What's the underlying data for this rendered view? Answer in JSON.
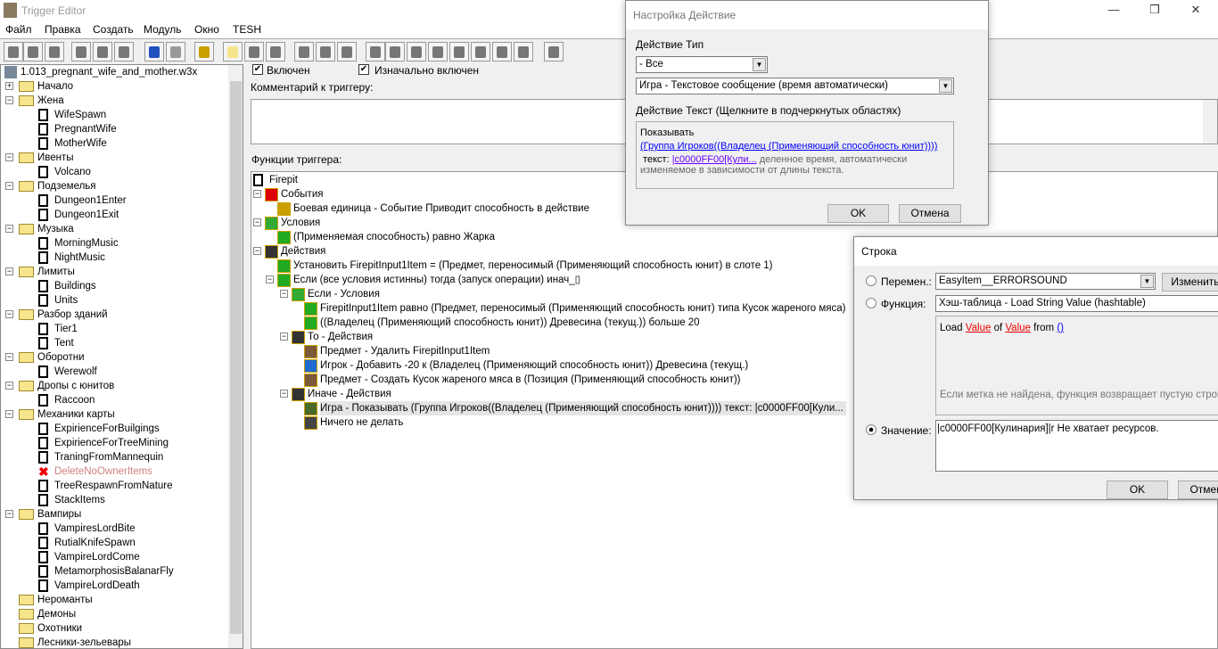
{
  "window": {
    "title": "Trigger Editor",
    "controls": [
      "—",
      "❐",
      "✕"
    ]
  },
  "menu": [
    "Файл",
    "Правка",
    "Создать",
    "Модуль",
    "Окно",
    "TESH"
  ],
  "toolbar": [
    "new",
    "open",
    "save",
    "cut",
    "copy",
    "paste",
    "undo",
    "redo",
    "variables",
    "new-category",
    "new-trigger",
    "new-comment",
    "new-event",
    "new-condition",
    "new-action",
    "terrain",
    "text",
    "sound",
    "unit",
    "item",
    "ai",
    "object",
    "import",
    "test"
  ],
  "left_tree": {
    "root": "1.013_pregnant_wife_and_mother.w3x",
    "items": [
      {
        "l": 0,
        "t": "folder",
        "e": "+",
        "label": "Начало"
      },
      {
        "l": 0,
        "t": "folder",
        "e": "-",
        "label": "Жена"
      },
      {
        "l": 1,
        "t": "trigger",
        "label": "WifeSpawn"
      },
      {
        "l": 1,
        "t": "trigger",
        "label": "PregnantWife"
      },
      {
        "l": 1,
        "t": "trigger",
        "label": "MotherWife"
      },
      {
        "l": 0,
        "t": "folder",
        "e": "-",
        "label": "Ивенты"
      },
      {
        "l": 1,
        "t": "trigger",
        "label": "Volcano"
      },
      {
        "l": 0,
        "t": "folder",
        "e": "-",
        "label": "Подземелья"
      },
      {
        "l": 1,
        "t": "trigger",
        "label": "Dungeon1Enter"
      },
      {
        "l": 1,
        "t": "trigger",
        "label": "Dungeon1Exit"
      },
      {
        "l": 0,
        "t": "folder",
        "e": "-",
        "label": "Музыка"
      },
      {
        "l": 1,
        "t": "trigger",
        "label": "MorningMusic"
      },
      {
        "l": 1,
        "t": "trigger",
        "label": "NightMusic"
      },
      {
        "l": 0,
        "t": "folder",
        "e": "-",
        "label": "Лимиты"
      },
      {
        "l": 1,
        "t": "trigger",
        "label": "Buildings"
      },
      {
        "l": 1,
        "t": "trigger",
        "label": "Units"
      },
      {
        "l": 0,
        "t": "folder",
        "e": "-",
        "label": "Разбор зданий"
      },
      {
        "l": 1,
        "t": "trigger",
        "label": "Tier1"
      },
      {
        "l": 1,
        "t": "trigger",
        "label": "Tent"
      },
      {
        "l": 0,
        "t": "folder",
        "e": "-",
        "label": "Оборотни"
      },
      {
        "l": 1,
        "t": "trigger",
        "label": "Werewolf"
      },
      {
        "l": 0,
        "t": "folder",
        "e": "-",
        "label": "Дропы с юнитов"
      },
      {
        "l": 1,
        "t": "trigger",
        "label": "Raccoon"
      },
      {
        "l": 0,
        "t": "folder",
        "e": "-",
        "label": "Механики карты"
      },
      {
        "l": 1,
        "t": "trigger",
        "label": "ExpirienceForBuilgings"
      },
      {
        "l": 1,
        "t": "trigger",
        "label": "ExpirienceForTreeMining"
      },
      {
        "l": 1,
        "t": "trigger",
        "label": "TraningFromMannequin"
      },
      {
        "l": 1,
        "t": "disabled",
        "label": "DeleteNoOwnerItems"
      },
      {
        "l": 1,
        "t": "trigger",
        "label": "TreeRespawnFromNature"
      },
      {
        "l": 1,
        "t": "trigger",
        "label": "StackItems"
      },
      {
        "l": 0,
        "t": "folder",
        "e": "-",
        "label": "Вампиры"
      },
      {
        "l": 1,
        "t": "trigger",
        "label": "VampiresLordBite"
      },
      {
        "l": 1,
        "t": "trigger",
        "label": "RutialKnifeSpawn"
      },
      {
        "l": 1,
        "t": "trigger",
        "label": "VampireLordCome"
      },
      {
        "l": 1,
        "t": "trigger",
        "label": "MetamorphosisBalanarFly"
      },
      {
        "l": 1,
        "t": "trigger",
        "label": "VampireLordDeath"
      },
      {
        "l": 0,
        "t": "folder",
        "label": "Нероманты"
      },
      {
        "l": 0,
        "t": "folder",
        "label": "Демоны"
      },
      {
        "l": 0,
        "t": "folder",
        "label": "Охотники"
      },
      {
        "l": 0,
        "t": "folder",
        "label": "Лесники-зельевары"
      }
    ]
  },
  "trigger": {
    "enabled_label": "Включен",
    "enabled": true,
    "initially_label": "Изначально включен",
    "initially": true,
    "comment_label": "Комментарий к триггеру:",
    "functions_label": "Функции триггера:",
    "functions": [
      {
        "l": 0,
        "i": "page",
        "label": "Firepit"
      },
      {
        "l": 1,
        "i": "flag",
        "e": "-",
        "label": "События"
      },
      {
        "l": 2,
        "i": "unit",
        "label": "Боевая единица - Событие Приводит способность в действие"
      },
      {
        "l": 1,
        "i": "cond",
        "e": "-",
        "label": "Условия"
      },
      {
        "l": 2,
        "i": "q",
        "label": "(Применяемая способность) равно Жарка"
      },
      {
        "l": 1,
        "i": "clap",
        "e": "-",
        "label": "Действия"
      },
      {
        "l": 2,
        "i": "set",
        "label": "Установить FirepitInput1Item = (Предмет, переносимый (Применяющий способность юнит) в слоте 1)"
      },
      {
        "l": 2,
        "i": "q",
        "e": "-",
        "label": "Если (все условия истинны) тогда (запуск операции) инач_▯"
      },
      {
        "l": 3,
        "i": "cond",
        "e": "-",
        "label": "Если - Условия"
      },
      {
        "l": 4,
        "i": "q",
        "label": "FirepitInput1Item равно (Предмет, переносимый (Применяющий способность юнит) типа Кусок жареного мяса)"
      },
      {
        "l": 4,
        "i": "q",
        "label": "((Владелец (Применяющий способность юнит)) Древесина (текущ.)) больше 20"
      },
      {
        "l": 3,
        "i": "clap",
        "e": "-",
        "label": "То - Действия"
      },
      {
        "l": 4,
        "i": "item",
        "label": "Предмет - Удалить FirepitInput1Item"
      },
      {
        "l": 4,
        "i": "player",
        "label": "Игрок - Добавить -20 к (Владелец (Применяющий способность юнит)) Древесина (текущ.)"
      },
      {
        "l": 4,
        "i": "item",
        "label": "Предмет - Создать Кусок жареного мяса в (Позиция (Применяющий способность юнит))"
      },
      {
        "l": 3,
        "i": "clap",
        "e": "-",
        "label": "Иначе - Действия"
      },
      {
        "l": 4,
        "i": "game",
        "sel": true,
        "label": "Игра - Показывать (Группа Игроков((Владелец (Применяющий способность юнит)))) текст: |c0000FF00[Кули..."
      },
      {
        "l": 4,
        "i": "gear",
        "label": "Ничего не делать"
      }
    ]
  },
  "action_dialog": {
    "title": "Настройка Действие",
    "type_label": "Действие Тип",
    "category": "- Все",
    "action": "Игра - Текстовое сообщение (время автоматически)",
    "text_label": "Действие Текст (Щелкните в подчеркнутых областях)",
    "line1": "Показывать",
    "link_group": "(Группа Игроков((Владелец (Применяющий способность юнит))))",
    "text_prefix": "текст:",
    "link_text": "|c0000FF00[Кули...",
    "desc1": "деленное время, автоматически",
    "desc2": "изменяемое в зависимости от длины текста.",
    "ok": "OK",
    "cancel": "Отмена"
  },
  "string_dialog": {
    "title": "Строка",
    "var_label": "Перемен.:",
    "var_value": "EasyItem__ERRORSOUND",
    "edit": "Изменить",
    "func_label": "Функция:",
    "func_value": "Хэш-таблица - Load String Value (hashtable)",
    "func_load": "Load",
    "func_value1": "Value",
    "func_of": "of",
    "func_value2": "Value",
    "func_from": "from",
    "func_paren": "()",
    "func_note": "Если метка не найдена, функция возвращает пустую строку.",
    "val_label": "Значение:",
    "val_value": "|c0000FF00[Кулинария]|r Не хватает ресурсов.",
    "selected": "value",
    "ok": "OK",
    "cancel": "Отмена"
  }
}
